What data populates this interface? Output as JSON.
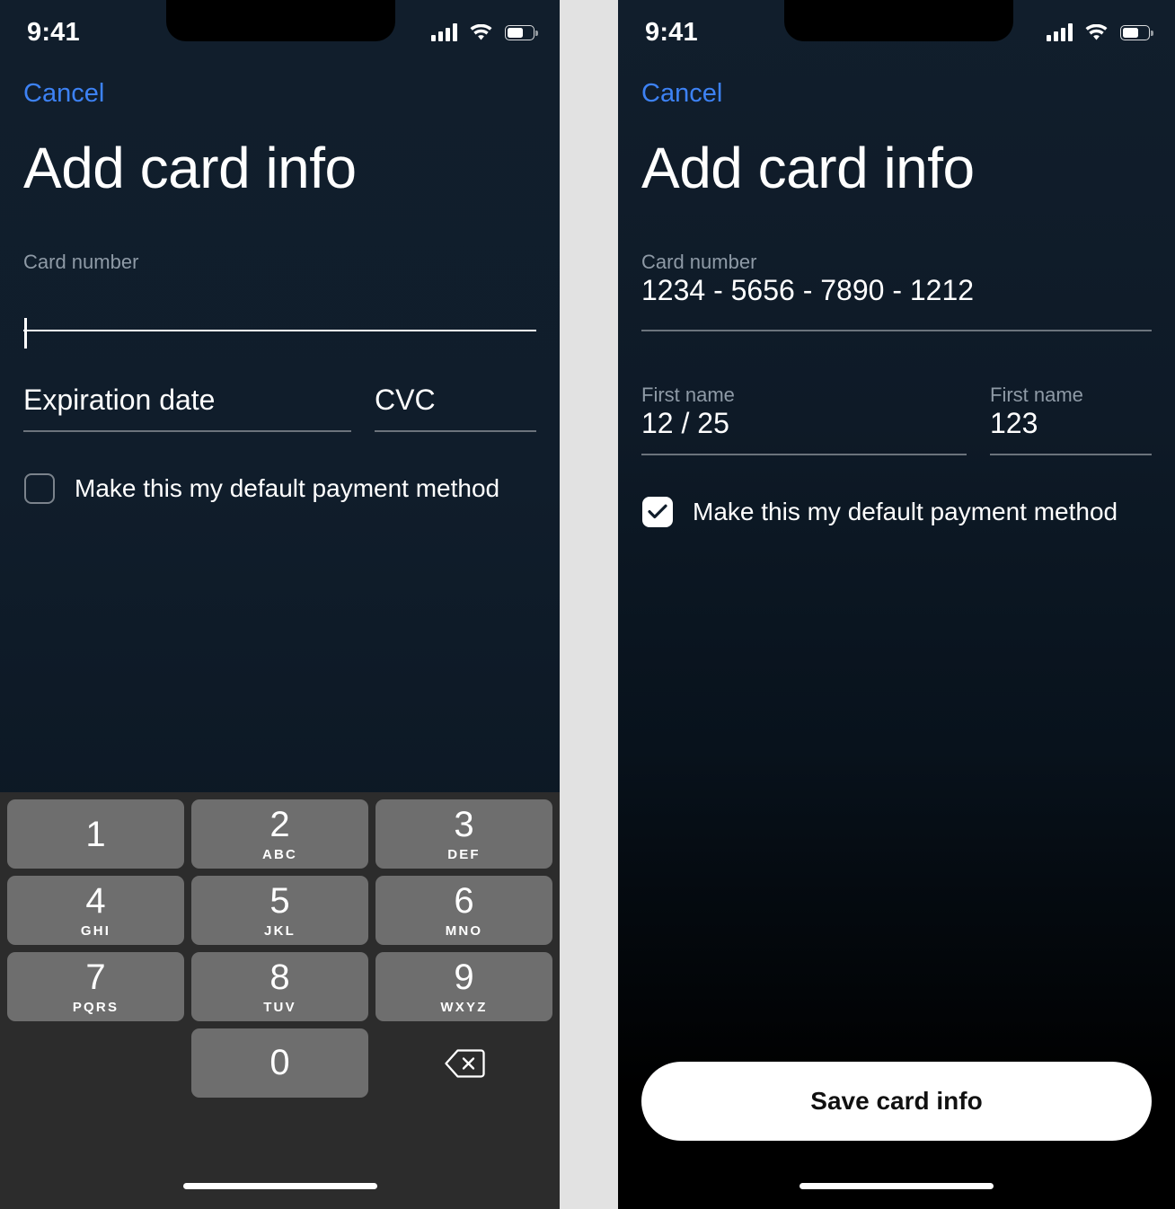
{
  "left_screen": {
    "status": {
      "time": "9:41",
      "signal_icon": "cellular-bars-icon",
      "wifi_icon": "wifi-icon",
      "battery_icon": "battery-icon"
    },
    "cancel_label": "Cancel",
    "title": "Add card info",
    "card_number": {
      "label": "Card number",
      "value": "",
      "focused": true
    },
    "expiration": {
      "label": "",
      "value": "Expiration date"
    },
    "cvc": {
      "label": "",
      "value": "CVC"
    },
    "checkbox": {
      "label": "Make this my default payment method",
      "checked": false
    },
    "keypad": {
      "keys": [
        {
          "num": "1",
          "sub": ""
        },
        {
          "num": "2",
          "sub": "ABC"
        },
        {
          "num": "3",
          "sub": "DEF"
        },
        {
          "num": "4",
          "sub": "GHI"
        },
        {
          "num": "5",
          "sub": "JKL"
        },
        {
          "num": "6",
          "sub": "MNO"
        },
        {
          "num": "7",
          "sub": "PQRS"
        },
        {
          "num": "8",
          "sub": "TUV"
        },
        {
          "num": "9",
          "sub": "WXYZ"
        }
      ],
      "zero": "0",
      "delete_icon": "backspace-icon"
    }
  },
  "right_screen": {
    "status": {
      "time": "9:41",
      "signal_icon": "cellular-bars-icon",
      "wifi_icon": "wifi-icon",
      "battery_icon": "battery-icon"
    },
    "cancel_label": "Cancel",
    "title": "Add card info",
    "card_number": {
      "label": "Card number",
      "value": "1234 - 5656 - 7890 - 1212"
    },
    "expiration": {
      "label": "First name",
      "value": "12 / 25"
    },
    "cvc": {
      "label": "First name",
      "value": "123"
    },
    "checkbox": {
      "label": "Make this my default payment method",
      "checked": true
    },
    "save_button": {
      "label": "Save card info"
    }
  },
  "colors": {
    "accent_blue": "#3d82f5",
    "bg_navy": "#111e2c",
    "key_gray": "#6e6e6e",
    "keyboard_bg": "#2c2c2c",
    "label_gray": "#8e9aa6"
  }
}
